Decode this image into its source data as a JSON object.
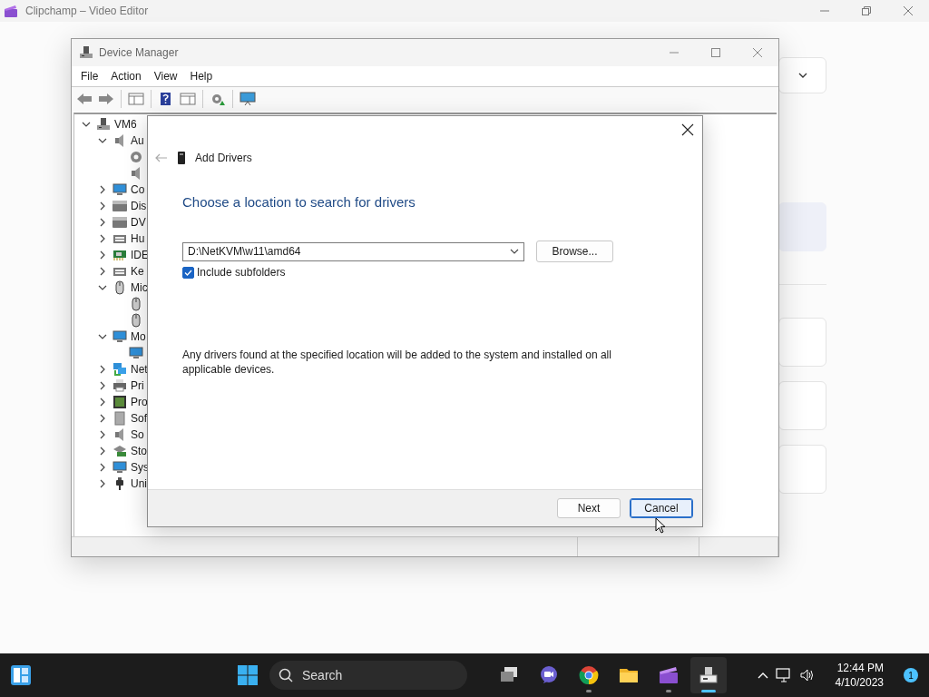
{
  "background_app": {
    "title": "Clipchamp – Video Editor"
  },
  "device_manager": {
    "title": "Device Manager",
    "menu": [
      "File",
      "Action",
      "View",
      "Help"
    ],
    "tree": [
      {
        "label": "VM6",
        "expanded": true,
        "children": [
          {
            "label": "Au",
            "expanded": true,
            "children": [
              {
                "kind": "device"
              },
              {
                "kind": "device"
              }
            ]
          },
          {
            "label": "Co",
            "expanded": false
          },
          {
            "label": "Dis",
            "expanded": false
          },
          {
            "label": "DV",
            "expanded": false
          },
          {
            "label": "Hu",
            "expanded": false
          },
          {
            "label": "IDE",
            "expanded": false
          },
          {
            "label": "Ke",
            "expanded": false
          },
          {
            "label": "Mic",
            "expanded": true,
            "children": [
              {
                "kind": "device"
              },
              {
                "kind": "device"
              }
            ]
          },
          {
            "label": "Mo",
            "expanded": true,
            "children": [
              {
                "kind": "device"
              }
            ]
          },
          {
            "label": "Net",
            "expanded": false
          },
          {
            "label": "Pri",
            "expanded": false
          },
          {
            "label": "Pro",
            "expanded": false
          },
          {
            "label": "Sof",
            "expanded": false
          },
          {
            "label": "So",
            "expanded": false
          },
          {
            "label": "Sto",
            "expanded": false
          },
          {
            "label": "Sys",
            "expanded": false
          },
          {
            "label": "Uni",
            "expanded": false
          }
        ]
      }
    ]
  },
  "dialog": {
    "title": "Add Drivers",
    "heading": "Choose a location to search for drivers",
    "location": {
      "value": "D:\\NetKVM\\w11\\amd64"
    },
    "browse": "Browse...",
    "include_subfolders": {
      "label": "Include subfolders",
      "checked": true
    },
    "note": "Any drivers found at the specified location will be added to the system and installed on all applicable devices.",
    "buttons": [
      {
        "label": "Next",
        "focused": false
      },
      {
        "label": "Cancel",
        "focused": true
      }
    ]
  },
  "taskbar": {
    "search": "Search",
    "apps": [
      {
        "kind": "taskview",
        "running": false,
        "selected": false
      },
      {
        "kind": "chat",
        "running": false,
        "selected": false
      },
      {
        "kind": "browser",
        "running": true,
        "selected": false
      },
      {
        "kind": "folder",
        "running": false,
        "selected": false
      },
      {
        "kind": "clapper",
        "running": true,
        "selected": false
      },
      {
        "kind": "devmgr",
        "running": true,
        "selected": true
      }
    ],
    "clock": {
      "time": "12:44 PM",
      "date": "4/10/2023"
    },
    "notifications": "1"
  }
}
